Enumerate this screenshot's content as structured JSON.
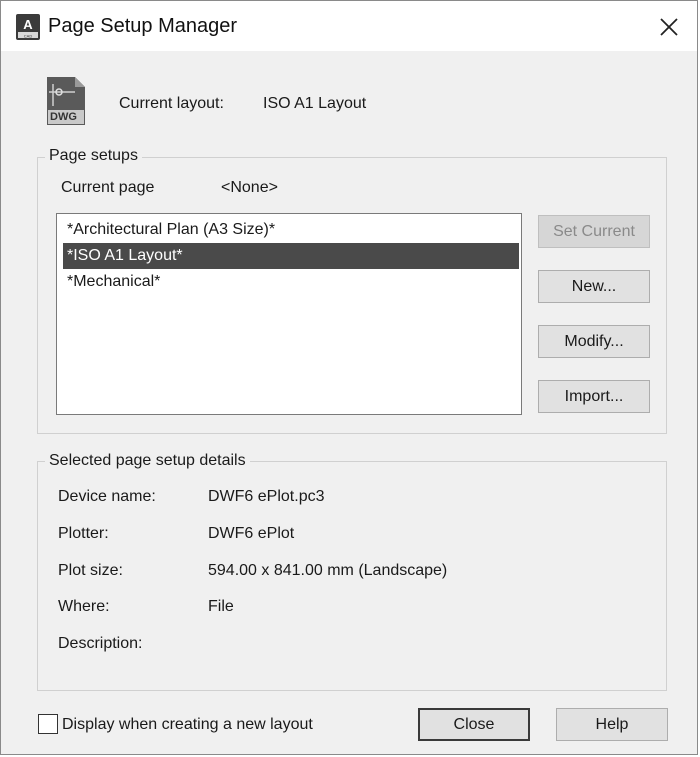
{
  "window": {
    "title": "Page Setup Manager",
    "app_icon": "autocad-icon",
    "close_icon": "close-icon"
  },
  "header": {
    "file_icon_label": "DWG",
    "current_layout_label": "Current layout:",
    "current_layout_value": "ISO A1 Layout"
  },
  "page_setups": {
    "legend": "Page setups",
    "current_page_label": "Current page",
    "current_page_value": "<None>",
    "items": [
      {
        "label": "*Architectural Plan (A3 Size)*",
        "selected": false
      },
      {
        "label": "*ISO A1 Layout*",
        "selected": true
      },
      {
        "label": "*Mechanical*",
        "selected": false
      }
    ],
    "buttons": {
      "set_current": "Set Current",
      "new": "New...",
      "modify": "Modify...",
      "import": "Import..."
    }
  },
  "details": {
    "legend": "Selected page setup details",
    "device_name_label": "Device name:",
    "device_name_value": "DWF6 ePlot.pc3",
    "plotter_label": "Plotter:",
    "plotter_value": "DWF6 ePlot",
    "plot_size_label": "Plot size:",
    "plot_size_value": "594.00 x 841.00 mm (Landscape)",
    "where_label": "Where:",
    "where_value": "File",
    "description_label": "Description:",
    "description_value": ""
  },
  "footer": {
    "checkbox_label": "Display when creating a new layout",
    "checkbox_checked": false,
    "close_button": "Close",
    "help_button": "Help"
  }
}
